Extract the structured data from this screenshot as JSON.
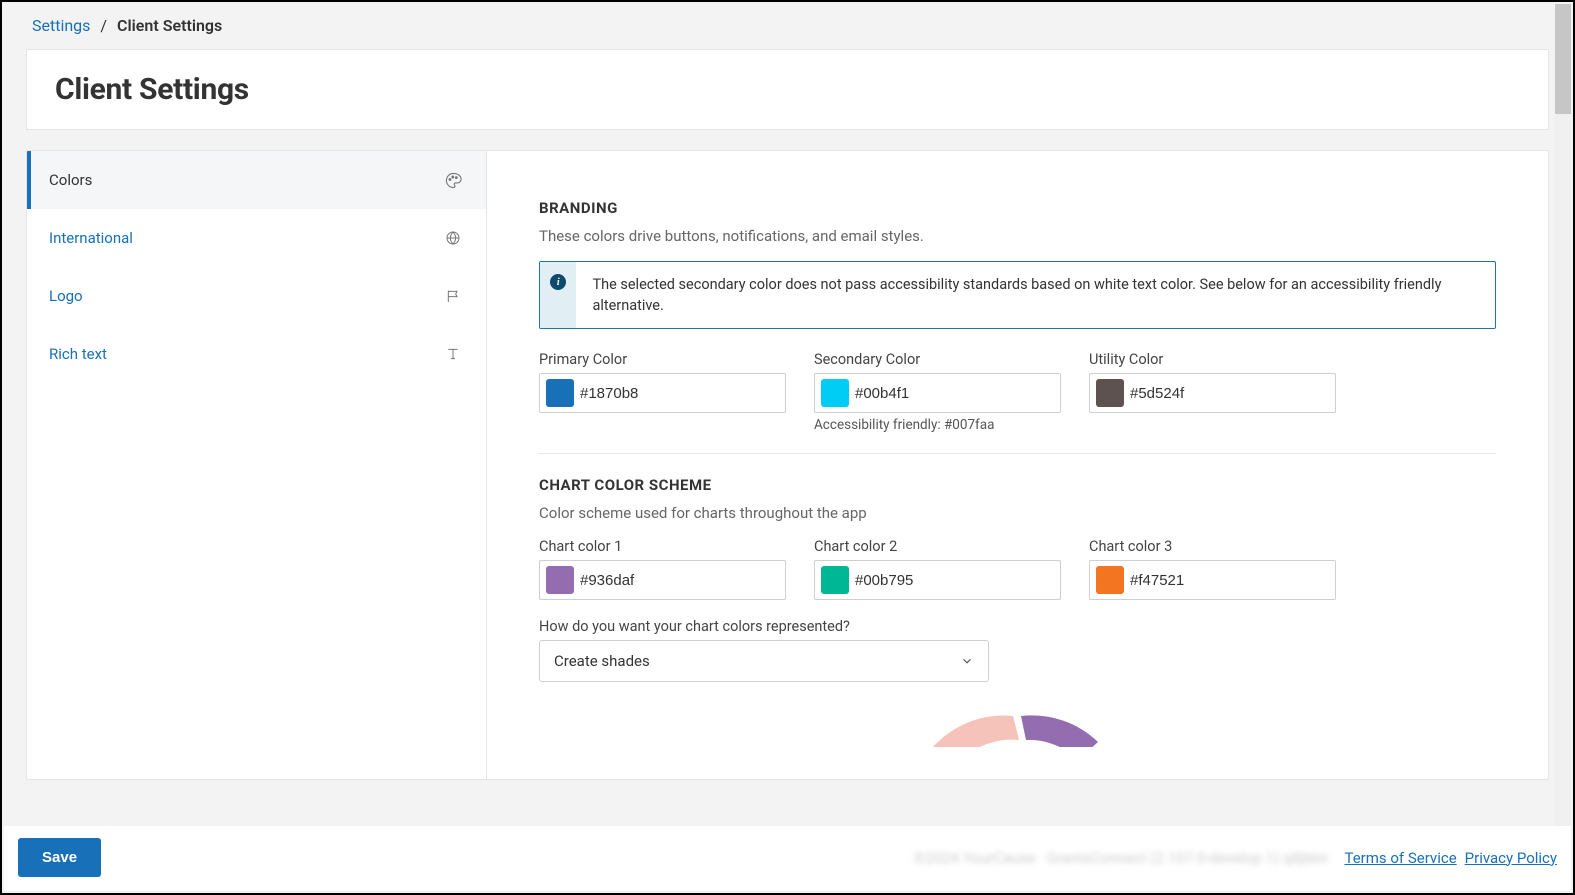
{
  "breadcrumb": {
    "root": "Settings",
    "current": "Client Settings"
  },
  "page_title": "Client Settings",
  "sidebar": {
    "items": [
      {
        "label": "Colors",
        "icon": "palette-icon",
        "active": true
      },
      {
        "label": "International",
        "icon": "globe-icon",
        "active": false
      },
      {
        "label": "Logo",
        "icon": "flag-icon",
        "active": false
      },
      {
        "label": "Rich text",
        "icon": "text-icon",
        "active": false
      }
    ]
  },
  "branding": {
    "title": "BRANDING",
    "description": "These colors drive buttons, notifications, and email styles.",
    "info_message": "The selected secondary color does not pass accessibility standards based on white text color. See below for an accessibility friendly alternative.",
    "primary": {
      "label": "Primary Color",
      "value": "#1870b8",
      "swatch": "#1870b8"
    },
    "secondary": {
      "label": "Secondary Color",
      "value": "#00b4f1",
      "swatch": "#00cdf5",
      "helper": "Accessibility friendly: #007faa"
    },
    "utility": {
      "label": "Utility Color",
      "value": "#5d524f",
      "swatch": "#5d524f"
    }
  },
  "chart_scheme": {
    "title": "CHART COLOR SCHEME",
    "description": "Color scheme used for charts throughout the app",
    "c1": {
      "label": "Chart color 1",
      "value": "#936daf",
      "swatch": "#936daf"
    },
    "c2": {
      "label": "Chart color 2",
      "value": "#00b795",
      "swatch": "#00b795"
    },
    "c3": {
      "label": "Chart color 3",
      "value": "#f47521",
      "swatch": "#f47521"
    },
    "representation_label": "How do you want your chart colors represented?",
    "representation_value": "Create shades"
  },
  "footer": {
    "save": "Save",
    "copyright": "©2024 YourCause · GrantsConnect (2.107.0-develop.1) q8jbbn",
    "terms": "Terms of Service",
    "privacy": "Privacy Policy"
  }
}
